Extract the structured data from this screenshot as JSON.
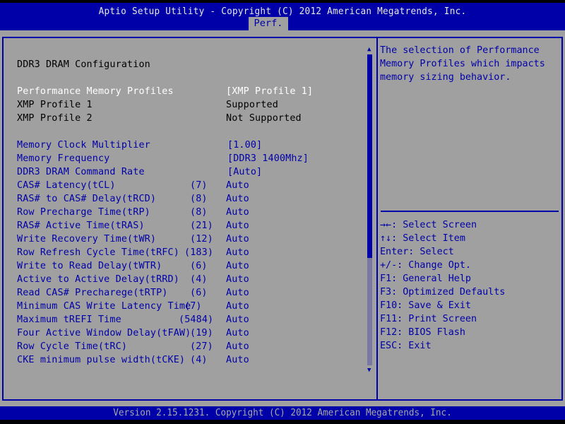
{
  "header": {
    "title": "Aptio Setup Utility - Copyright (C) 2012 American Megatrends, Inc.",
    "active_tab": "Perf."
  },
  "main": {
    "section_title": "DDR3 DRAM Configuration",
    "profile_rows": [
      {
        "label": "Performance Memory Profiles",
        "value": "[XMP Profile 1]",
        "selected": true
      },
      {
        "label": "XMP Profile 1",
        "value": "Supported"
      },
      {
        "label": "XMP Profile 2",
        "value": "Not Supported"
      }
    ],
    "settings": [
      {
        "label": "Memory Clock Multiplier",
        "current": "",
        "value": "[1.00]"
      },
      {
        "label": "Memory Frequency",
        "current": "",
        "value": "[DDR3 1400Mhz]"
      },
      {
        "label": "DDR3 DRAM Command Rate",
        "current": "",
        "value": "[Auto]"
      },
      {
        "label": "CAS# Latency(tCL)",
        "current": "(7)",
        "value": "Auto"
      },
      {
        "label": "RAS# to CAS# Delay(tRCD)",
        "current": "(8)",
        "value": "Auto"
      },
      {
        "label": "Row Precharge Time(tRP)",
        "current": "(8)",
        "value": "Auto"
      },
      {
        "label": "RAS# Active Time(tRAS)",
        "current": "(21)",
        "value": "Auto"
      },
      {
        "label": "Write Recovery Time(tWR)",
        "current": "(12)",
        "value": "Auto"
      },
      {
        "label": "Row Refresh Cycle Time(tRFC)",
        "current": "(183)",
        "value": "Auto"
      },
      {
        "label": "Write to Read Delay(tWTR)",
        "current": "(6)",
        "value": "Auto"
      },
      {
        "label": "Active to Active Delay(tRRD)",
        "current": "(4)",
        "value": "Auto"
      },
      {
        "label": "Read CAS# Precharege(tRTP)",
        "current": "(6)",
        "value": "Auto"
      },
      {
        "label": "Minimum CAS Write Latency Time",
        "current": "(7)",
        "value": "Auto"
      },
      {
        "label": "Maximum tREFI Time",
        "current": "(5484)",
        "value": "Auto"
      },
      {
        "label": "Four Active Window Delay(tFAW)",
        "current": "(19)",
        "value": "Auto"
      },
      {
        "label": "Row Cycle Time(tRC)",
        "current": "(27)",
        "value": "Auto"
      },
      {
        "label": "CKE minimum pulse width(tCKE)",
        "current": "(4)",
        "value": "Auto"
      }
    ],
    "scrollbar": {
      "thumb_fraction": 0.65,
      "position_fraction": 0.0
    }
  },
  "help": {
    "description": "The selection of Performance\nMemory Profiles which impacts\nmemory sizing behavior.",
    "keys": [
      "→←: Select Screen",
      "↑↓: Select Item",
      "Enter: Select",
      "+/-: Change Opt.",
      "F1: General Help",
      "F3: Optimized Defaults",
      "F10: Save & Exit",
      "F11: Print Screen",
      "F12: BIOS Flash",
      "ESC: Exit"
    ]
  },
  "footer": {
    "text": "Version 2.15.1231. Copyright (C) 2012 American Megatrends, Inc."
  },
  "colors": {
    "header_bg": "#0000a8",
    "body_bg": "#a0a0a0",
    "highlight": "#ffffff",
    "setting_text": "#0000a8"
  }
}
